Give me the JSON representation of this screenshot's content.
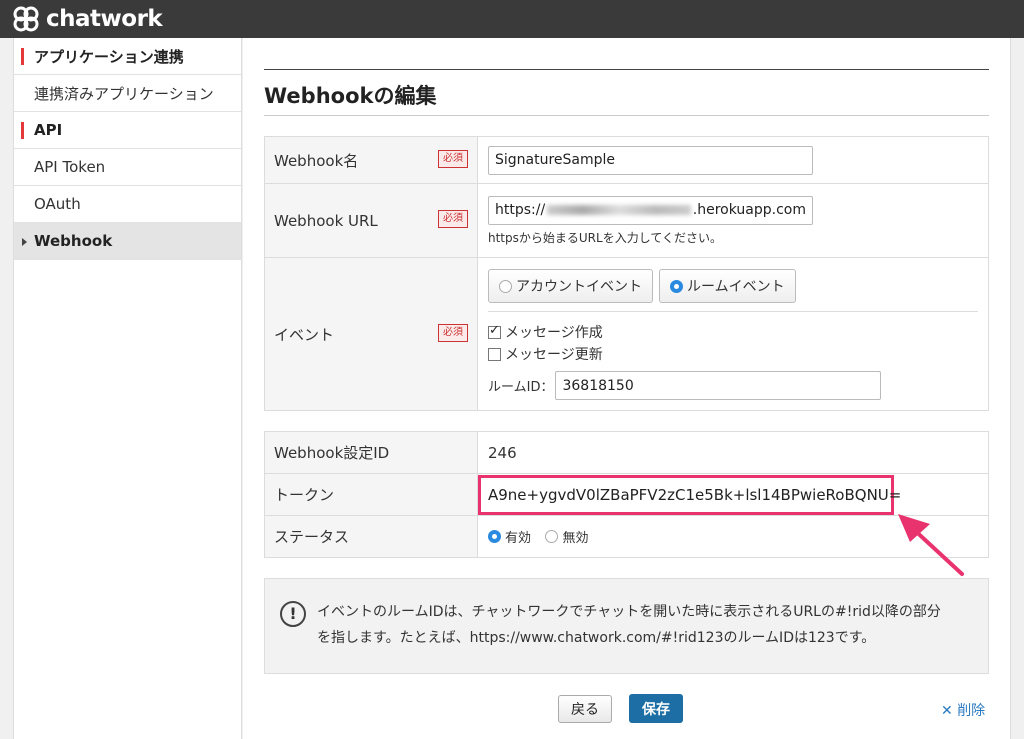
{
  "app": {
    "logo_text": "chatwork"
  },
  "sidebar": {
    "sections": [
      {
        "heading": "アプリケーション連携",
        "items": [
          "連携済みアプリケーション"
        ]
      },
      {
        "heading": "API",
        "items": [
          "API Token",
          "OAuth",
          "Webhook"
        ]
      }
    ],
    "active": "Webhook"
  },
  "page": {
    "title": "Webhookの編集"
  },
  "form": {
    "required_badge": "必須",
    "name": {
      "label": "Webhook名",
      "value": "SignatureSample"
    },
    "url": {
      "label": "Webhook URL",
      "value_prefix": "https://",
      "value_suffix": ".herokuapp.com",
      "hint": "httpsから始まるURLを入力してください。"
    },
    "event": {
      "label": "イベント",
      "option_account": "アカウントイベント",
      "option_room": "ルームイベント",
      "selected": "ルームイベント",
      "check_create": "メッセージ作成",
      "check_create_checked": true,
      "check_update": "メッセージ更新",
      "check_update_checked": false,
      "room_id_label": "ルームID：",
      "room_id_value": "36818150"
    }
  },
  "info": {
    "id_label": "Webhook設定ID",
    "id_value": "246",
    "token_label": "トークン",
    "token_value": "A9ne+ygvdV0lZBaPFV2zC1e5Bk+lsl14BPwieRoBQNU=",
    "status_label": "ステータス",
    "status_enabled": "有効",
    "status_disabled": "無効",
    "status_selected": "有効"
  },
  "note": {
    "icon": "exclamation-icon",
    "text_line1": "イベントのルームIDは、チャットワークでチャットを開いた時に表示されるURLの#!rid以降の部分",
    "text_line2": "を指します。たとえば、https://www.chatwork.com/#!rid123のルームIDは123です。"
  },
  "actions": {
    "back": "戻る",
    "save": "保存",
    "delete": "削除"
  },
  "colors": {
    "topbar": "#3a3a3a",
    "accent_red": "#e5383b",
    "save_blue": "#1c6ea4",
    "highlight_pink": "#e8336e",
    "link_blue": "#2a7ac0"
  }
}
